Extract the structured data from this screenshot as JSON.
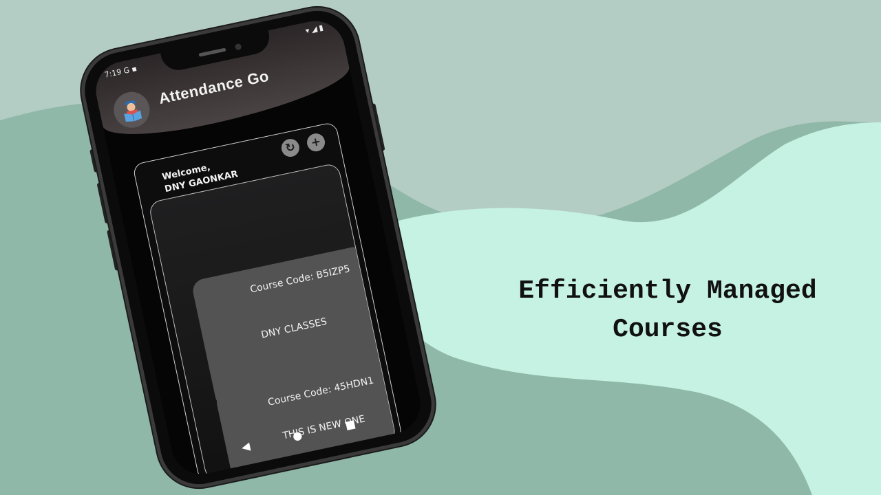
{
  "tagline": {
    "line1": "Efficiently Managed",
    "line2": "Courses"
  },
  "status_bar": {
    "time": "7:19",
    "left_icons": "G ▪",
    "right_icons": "▾◢▮"
  },
  "app": {
    "title": "Attendance Go"
  },
  "welcome": {
    "greeting": "Welcome,",
    "name": "DNY GAONKAR"
  },
  "buttons": {
    "refresh_icon": "↻",
    "add_icon": "+"
  },
  "courses": [
    {
      "code": "Course Code: B5IZP5",
      "name": "DNY CLASSES"
    },
    {
      "code": "Course Code: 45HDN1",
      "name": "THIS IS NEW ONE"
    }
  ],
  "nav": {
    "back": "◀",
    "home": "●",
    "recents": "■"
  },
  "colors": {
    "bg_top": "#b4cdc4",
    "bg_wave_light": "#c5f2e2",
    "bg_wave_dark": "#8fb8a8"
  }
}
